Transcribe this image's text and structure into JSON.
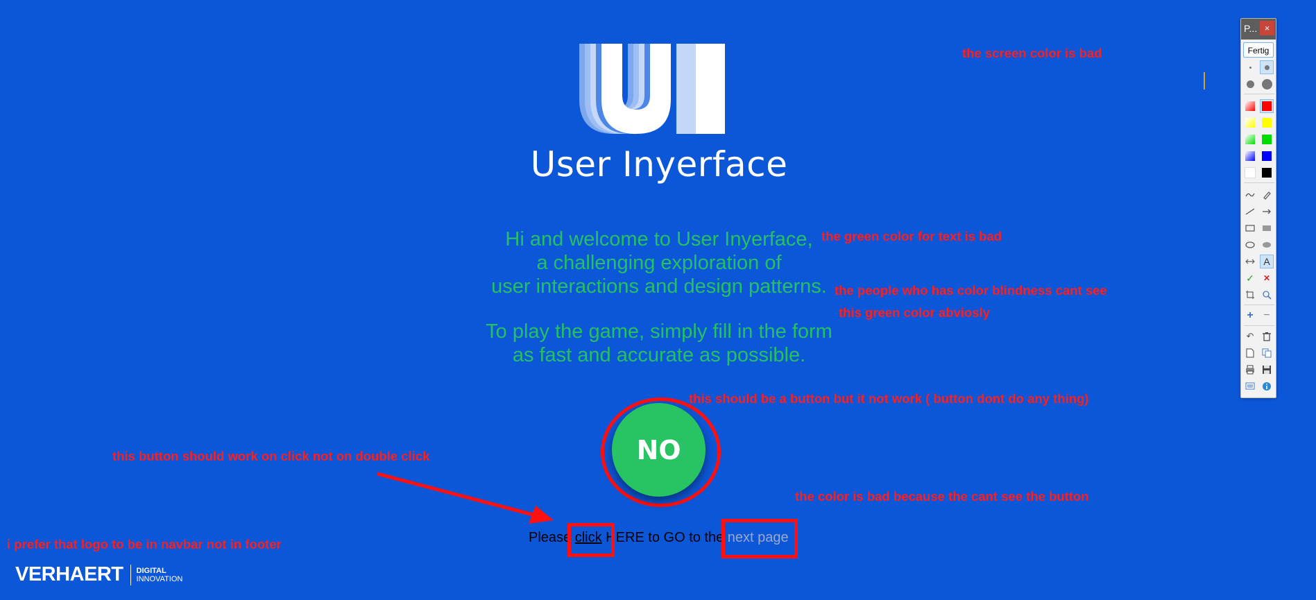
{
  "app": {
    "title": "User Inyerface",
    "logo_letters": "UI"
  },
  "welcome": {
    "lines": [
      "Hi and welcome to User Inyerface,",
      "a challenging exploration of",
      "user interactions and design patterns."
    ]
  },
  "instructions": {
    "lines": [
      "To play the game, simply fill in the form",
      "as fast and accurate as possible."
    ]
  },
  "no_button": {
    "label": "NO"
  },
  "footer_link": {
    "prefix": "Please ",
    "click": "click",
    "middle": " HERE to GO to the",
    "next": " next page"
  },
  "brand": {
    "name": "VERHAERT",
    "line1": "DIGITAL",
    "line2": "INNOVATION"
  },
  "annotations": {
    "screen_color": "the screen color is bad",
    "green_text": "the green color for text is bad",
    "color_blind_1": "the people who has color blindness cant see",
    "color_blind_2": "this green color abviosly",
    "button_not_work": "this should be a button but it not work ( button dont do any thing)",
    "double_click": "this button should work on click not on double click",
    "cant_see_button": "the color is bad because the cant see the button",
    "logo_navbar": "i prefer that logo to be in navbar not in footer"
  },
  "palette": {
    "title": "P...",
    "close_icon": "×",
    "done_label": "Fertig",
    "colors": [
      "#ff0000",
      "#ffff00",
      "#00dd00",
      "#0000ff",
      "#ffffff",
      "#000000"
    ]
  },
  "colors": {
    "background": "#0c57d8",
    "green_text": "#26c063",
    "annotation_red": "#ff1d1d"
  }
}
